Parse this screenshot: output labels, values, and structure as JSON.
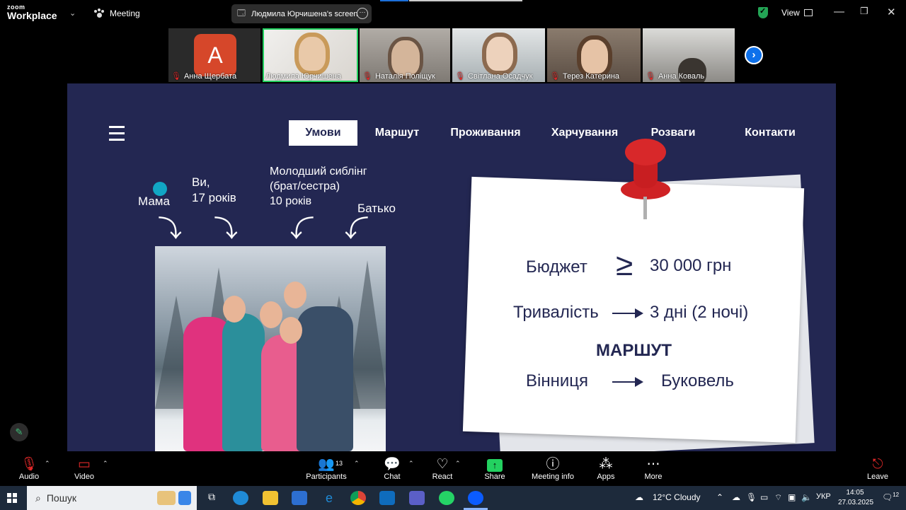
{
  "app": {
    "logo_small": "zoom",
    "logo_name": "Workplace",
    "meeting_label": "Meeting",
    "share_banner": "Людмила Юрчишена's screen",
    "view_label": "View"
  },
  "participants": [
    {
      "name": "Анна Щербата",
      "muted": true,
      "avatar_letter": "A"
    },
    {
      "name": "Людмила Юрчишена",
      "muted": false,
      "active": true
    },
    {
      "name": "Наталія Поліщук",
      "muted": true
    },
    {
      "name": "Світлана Осадчук",
      "muted": true
    },
    {
      "name": "Терез Катерина",
      "muted": true
    },
    {
      "name": "Анна Коваль",
      "muted": true
    }
  ],
  "slide": {
    "nav": [
      "Умови",
      "Маршут",
      "Проживання",
      "Харчування",
      "Розваги",
      "Контакти"
    ],
    "selected_nav": "Умови",
    "labels": {
      "mom": "Мама",
      "you_line1": "Ви,",
      "you_line2": "17 років",
      "sibling_line1": "Молодший сиблінг",
      "sibling_line2": "(брат/сестра)",
      "sibling_line3": "10 років",
      "dad": "Батько"
    },
    "note": {
      "budget_label": "Бюджет",
      "budget_symbol": "≥",
      "budget_value": "30 000 грн",
      "duration_label": "Тривалість",
      "duration_value": "3 дні (2 ночі)",
      "route_title": "МАРШУТ",
      "route_from": "Вінниця",
      "route_to": "Буковель"
    }
  },
  "toolbar": {
    "audio": "Audio",
    "video": "Video",
    "participants": "Participants",
    "participants_count": "13",
    "chat": "Chat",
    "react": "React",
    "share": "Share",
    "meeting_info": "Meeting info",
    "apps": "Apps",
    "more": "More",
    "leave": "Leave"
  },
  "taskbar": {
    "search_placeholder": "Пошук",
    "weather": "12°C  Cloudy",
    "language": "УКР",
    "time": "14:05",
    "date": "27.03.2025",
    "notifications": "12"
  }
}
